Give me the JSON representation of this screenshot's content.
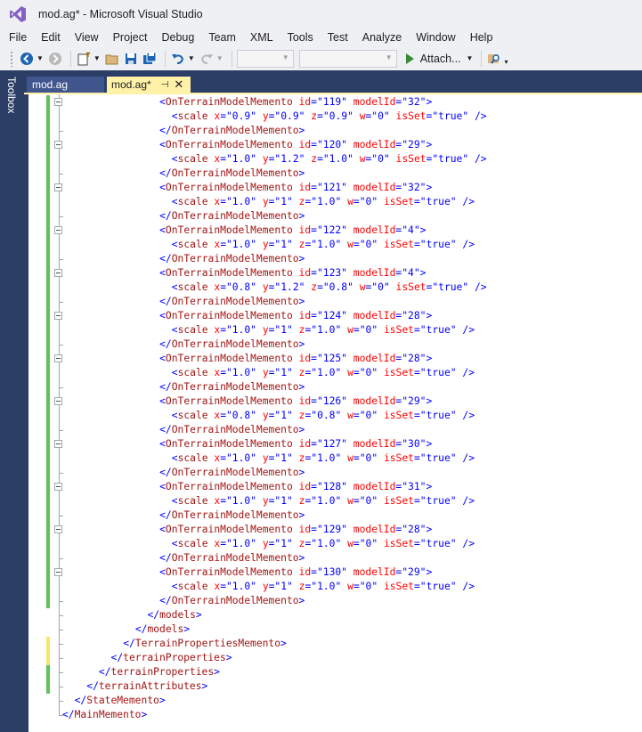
{
  "window": {
    "title": "mod.ag* - Microsoft Visual Studio"
  },
  "menu": [
    "File",
    "Edit",
    "View",
    "Project",
    "Debug",
    "Team",
    "XML",
    "Tools",
    "Test",
    "Analyze",
    "Window",
    "Help"
  ],
  "toolbar": {
    "attach_label": "Attach...",
    "combo1_value": "",
    "combo2_value": ""
  },
  "sidebar": {
    "toolbox_label": "Toolbox"
  },
  "tabs": [
    {
      "label": "mod.ag",
      "active": false
    },
    {
      "label": "mod.ag*",
      "active": true
    }
  ],
  "colors": {
    "accent_tab": "#fff1a8",
    "chrome_dark": "#2d3e66",
    "tag": "#0000ff",
    "element_name": "#a31515",
    "attribute": "#ff0000",
    "change_saved": "#5ec25e",
    "change_unsaved": "#f7e66b"
  },
  "editor": {
    "memento_items": [
      {
        "id": "119",
        "modelId": "32",
        "x": "0.9",
        "y": "0.9",
        "z": "0.9",
        "w": "0",
        "isSet": "true"
      },
      {
        "id": "120",
        "modelId": "29",
        "x": "1.0",
        "y": "1.2",
        "z": "1.0",
        "w": "0",
        "isSet": "true"
      },
      {
        "id": "121",
        "modelId": "32",
        "x": "1.0",
        "y": "1",
        "z": "1.0",
        "w": "0",
        "isSet": "true"
      },
      {
        "id": "122",
        "modelId": "4",
        "x": "1.0",
        "y": "1",
        "z": "1.0",
        "w": "0",
        "isSet": "true"
      },
      {
        "id": "123",
        "modelId": "4",
        "x": "0.8",
        "y": "1.2",
        "z": "0.8",
        "w": "0",
        "isSet": "true"
      },
      {
        "id": "124",
        "modelId": "28",
        "x": "1.0",
        "y": "1",
        "z": "1.0",
        "w": "0",
        "isSet": "true"
      },
      {
        "id": "125",
        "modelId": "28",
        "x": "1.0",
        "y": "1",
        "z": "1.0",
        "w": "0",
        "isSet": "true"
      },
      {
        "id": "126",
        "modelId": "29",
        "x": "0.8",
        "y": "1",
        "z": "0.8",
        "w": "0",
        "isSet": "true"
      },
      {
        "id": "127",
        "modelId": "30",
        "x": "1.0",
        "y": "1",
        "z": "1.0",
        "w": "0",
        "isSet": "true"
      },
      {
        "id": "128",
        "modelId": "31",
        "x": "1.0",
        "y": "1",
        "z": "1.0",
        "w": "0",
        "isSet": "true"
      },
      {
        "id": "129",
        "modelId": "28",
        "x": "1.0",
        "y": "1",
        "z": "1.0",
        "w": "0",
        "isSet": "true"
      },
      {
        "id": "130",
        "modelId": "29",
        "x": "1.0",
        "y": "1",
        "z": "1.0",
        "w": "0",
        "isSet": "true"
      }
    ],
    "memento_element": "OnTerrainModelMemento",
    "scale_element": "scale",
    "closing_tags": [
      {
        "indent": 7,
        "name": "models"
      },
      {
        "indent": 6,
        "name": "models"
      },
      {
        "indent": 5,
        "name": "TerrainPropertiesMemento"
      },
      {
        "indent": 4,
        "name": "terrainProperties"
      },
      {
        "indent": 3,
        "name": "terrainProperties"
      },
      {
        "indent": 2,
        "name": "terrainAttributes"
      },
      {
        "indent": 1,
        "name": "StateMemento"
      },
      {
        "indent": 0,
        "name": "MainMemento"
      }
    ]
  }
}
